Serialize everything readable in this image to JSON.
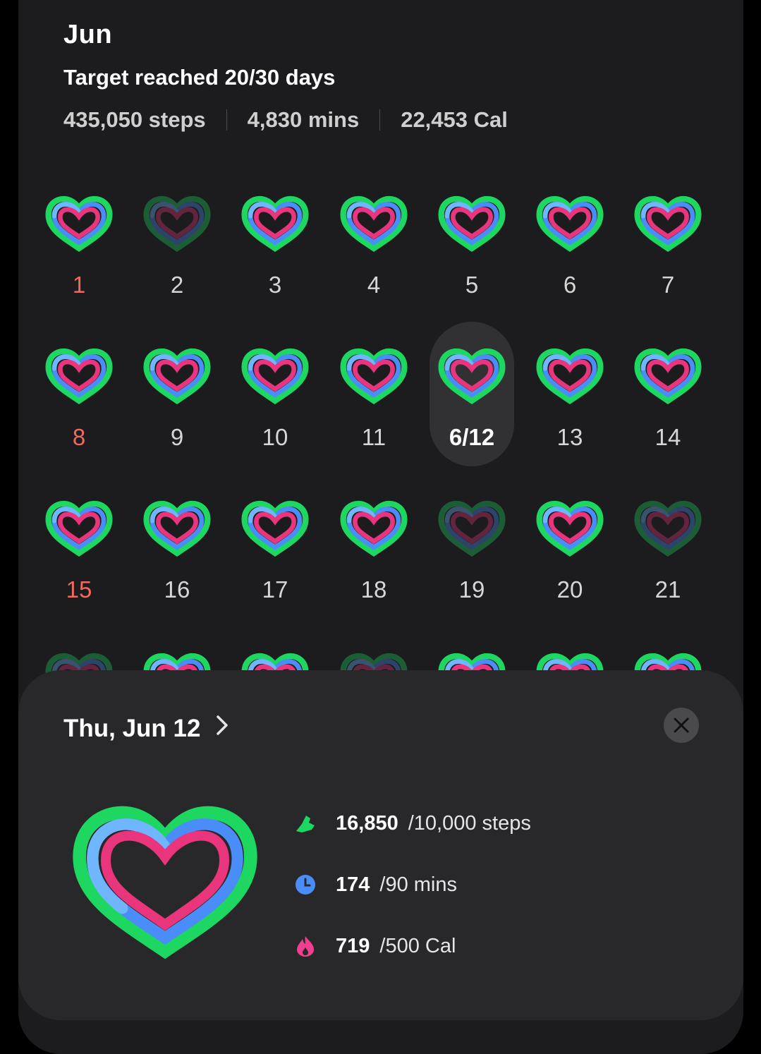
{
  "header": {
    "month": "Jun",
    "target_text": "Target reached 20/30 days",
    "steps_total": "435,050 steps",
    "mins_total": "4,830 mins",
    "cal_total": "22,453 Cal"
  },
  "calendar": {
    "days": [
      "1",
      "2",
      "3",
      "4",
      "5",
      "6",
      "7",
      "8",
      "9",
      "10",
      "11",
      "6/12",
      "13",
      "14",
      "15",
      "16",
      "17",
      "18",
      "19",
      "20",
      "21"
    ],
    "sunday_days": [
      "1",
      "8",
      "15"
    ],
    "selected_day": "6/12"
  },
  "detail": {
    "date_label": "Thu, Jun 12",
    "steps_value": "16,850",
    "steps_goal": "/10,000 steps",
    "mins_value": "174",
    "mins_goal": "/90 mins",
    "cal_value": "719",
    "cal_goal": "/500 Cal"
  },
  "colors": {
    "steps_green": "#1ed760",
    "mins_blue": "#4b8df8",
    "mins_light_blue": "#6fb6ff",
    "cal_pink": "#e8357b",
    "sunday_red": "#ef6a5d"
  },
  "icons": {
    "steps": "shoe-icon",
    "mins": "clock-icon",
    "cal": "flame-icon",
    "close": "close-icon",
    "chevron": "chevron-right-icon"
  }
}
